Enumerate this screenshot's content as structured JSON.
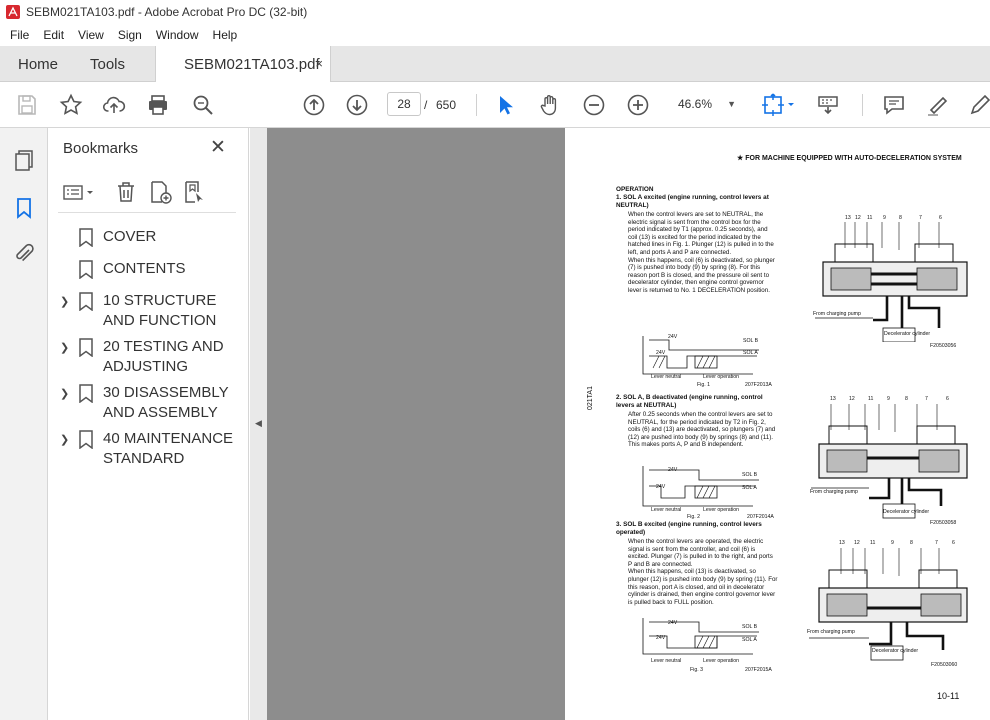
{
  "window": {
    "title": "SEBM021TA103.pdf - Adobe Acrobat Pro DC (32-bit)"
  },
  "menu": [
    "File",
    "Edit",
    "View",
    "Sign",
    "Window",
    "Help"
  ],
  "tabs": {
    "home": "Home",
    "tools": "Tools",
    "document": "SEBM021TA103.pdf",
    "close_symbol": "×"
  },
  "toolbar": {
    "page_current": "28",
    "page_separator": "/",
    "page_total": "650",
    "zoom": "46.6%"
  },
  "bookmarks": {
    "title": "Bookmarks",
    "close_symbol": "✕",
    "items": [
      {
        "label": "COVER",
        "expandable": false
      },
      {
        "label": "CONTENTS",
        "expandable": false
      },
      {
        "label": "10 STRUCTURE AND FUNCTION",
        "expandable": true
      },
      {
        "label": "20 TESTING AND ADJUSTING",
        "expandable": true
      },
      {
        "label": "30 DISASSEMBLY AND ASSEMBLY",
        "expandable": true
      },
      {
        "label": "40 MAINTENANCE STANDARD",
        "expandable": true
      }
    ]
  },
  "document": {
    "header": "★  FOR MACHINE EQUIPPED WITH AUTO-DECELERATION SYSTEM",
    "operation_heading": "OPERATION",
    "side_code": "021TA1",
    "page_number": "10-11",
    "sections": [
      {
        "heading": "1.  SOL A excited (engine running, control levers at NEUTRAL)",
        "body": "When the control levers are set to NEUTRAL, the electric signal is sent from the control box for the period indicated by T1 (approx. 0.25 seconds), and coil (13) is excited for the period indicated by the hatched lines in Fig. 1. Plunger (12) is pulled in to the left, and ports A and P are connected.\nWhen this happens, coil (6) is deactivated, so plunger (7) is pushed into body (9) by spring (8). For this reason port B is closed, and the pressure oil sent to decelerator cylinder, then engine control governor lever is returned to No. 1 DECELERATION position.",
        "fig_label": "Fig. 1",
        "fig_code": "207F2013A",
        "diagram_code": "F20503056"
      },
      {
        "heading": "2.  SOL A, B deactivated (engine running, control levers at NEUTRAL)",
        "body": "After 0.25 seconds when the control levers are set to NEUTRAL, for the period indicated by T2 in Fig. 2, coils (6) and (13) are deactivated, so plungers (7) and (12) are pushed into body (9) by springs (8) and (11). This makes ports A, P and B independent.",
        "fig_label": "Fig. 2",
        "fig_code": "207F2014A",
        "diagram_code": "F20503058"
      },
      {
        "heading": "3.  SOL B excited (engine running, control levers operated)",
        "body": "When the control levers are operated, the electric signal is sent from the controller, and coil (6) is excited. Plunger (7) is pulled in to the right, and ports P and B are connected.\nWhen this happens, coil (13) is deactivated, so plunger (12) is pushed into body (9) by spring (11). For this reason, port A is closed, and oil in decelerator cylinder is drained, then engine control governor lever is pulled back to FULL position.",
        "fig_label": "Fig. 3",
        "fig_code": "207F2015A",
        "diagram_code": "F20503060"
      }
    ],
    "timing": {
      "voltage": "24V",
      "zero": "0",
      "sol_b": "SOL B",
      "sol_a": "SOL A",
      "lever_neutral": "Lever neutral",
      "lever_operation": "Lever operation",
      "t1": "T1",
      "t2": "T2"
    },
    "callouts": [
      "13",
      "12",
      "11",
      "9",
      "8",
      "7",
      "6"
    ],
    "diagram_labels": {
      "from_pump": "From charging pump",
      "decel_cyl": "Decelerator cylinder"
    }
  }
}
